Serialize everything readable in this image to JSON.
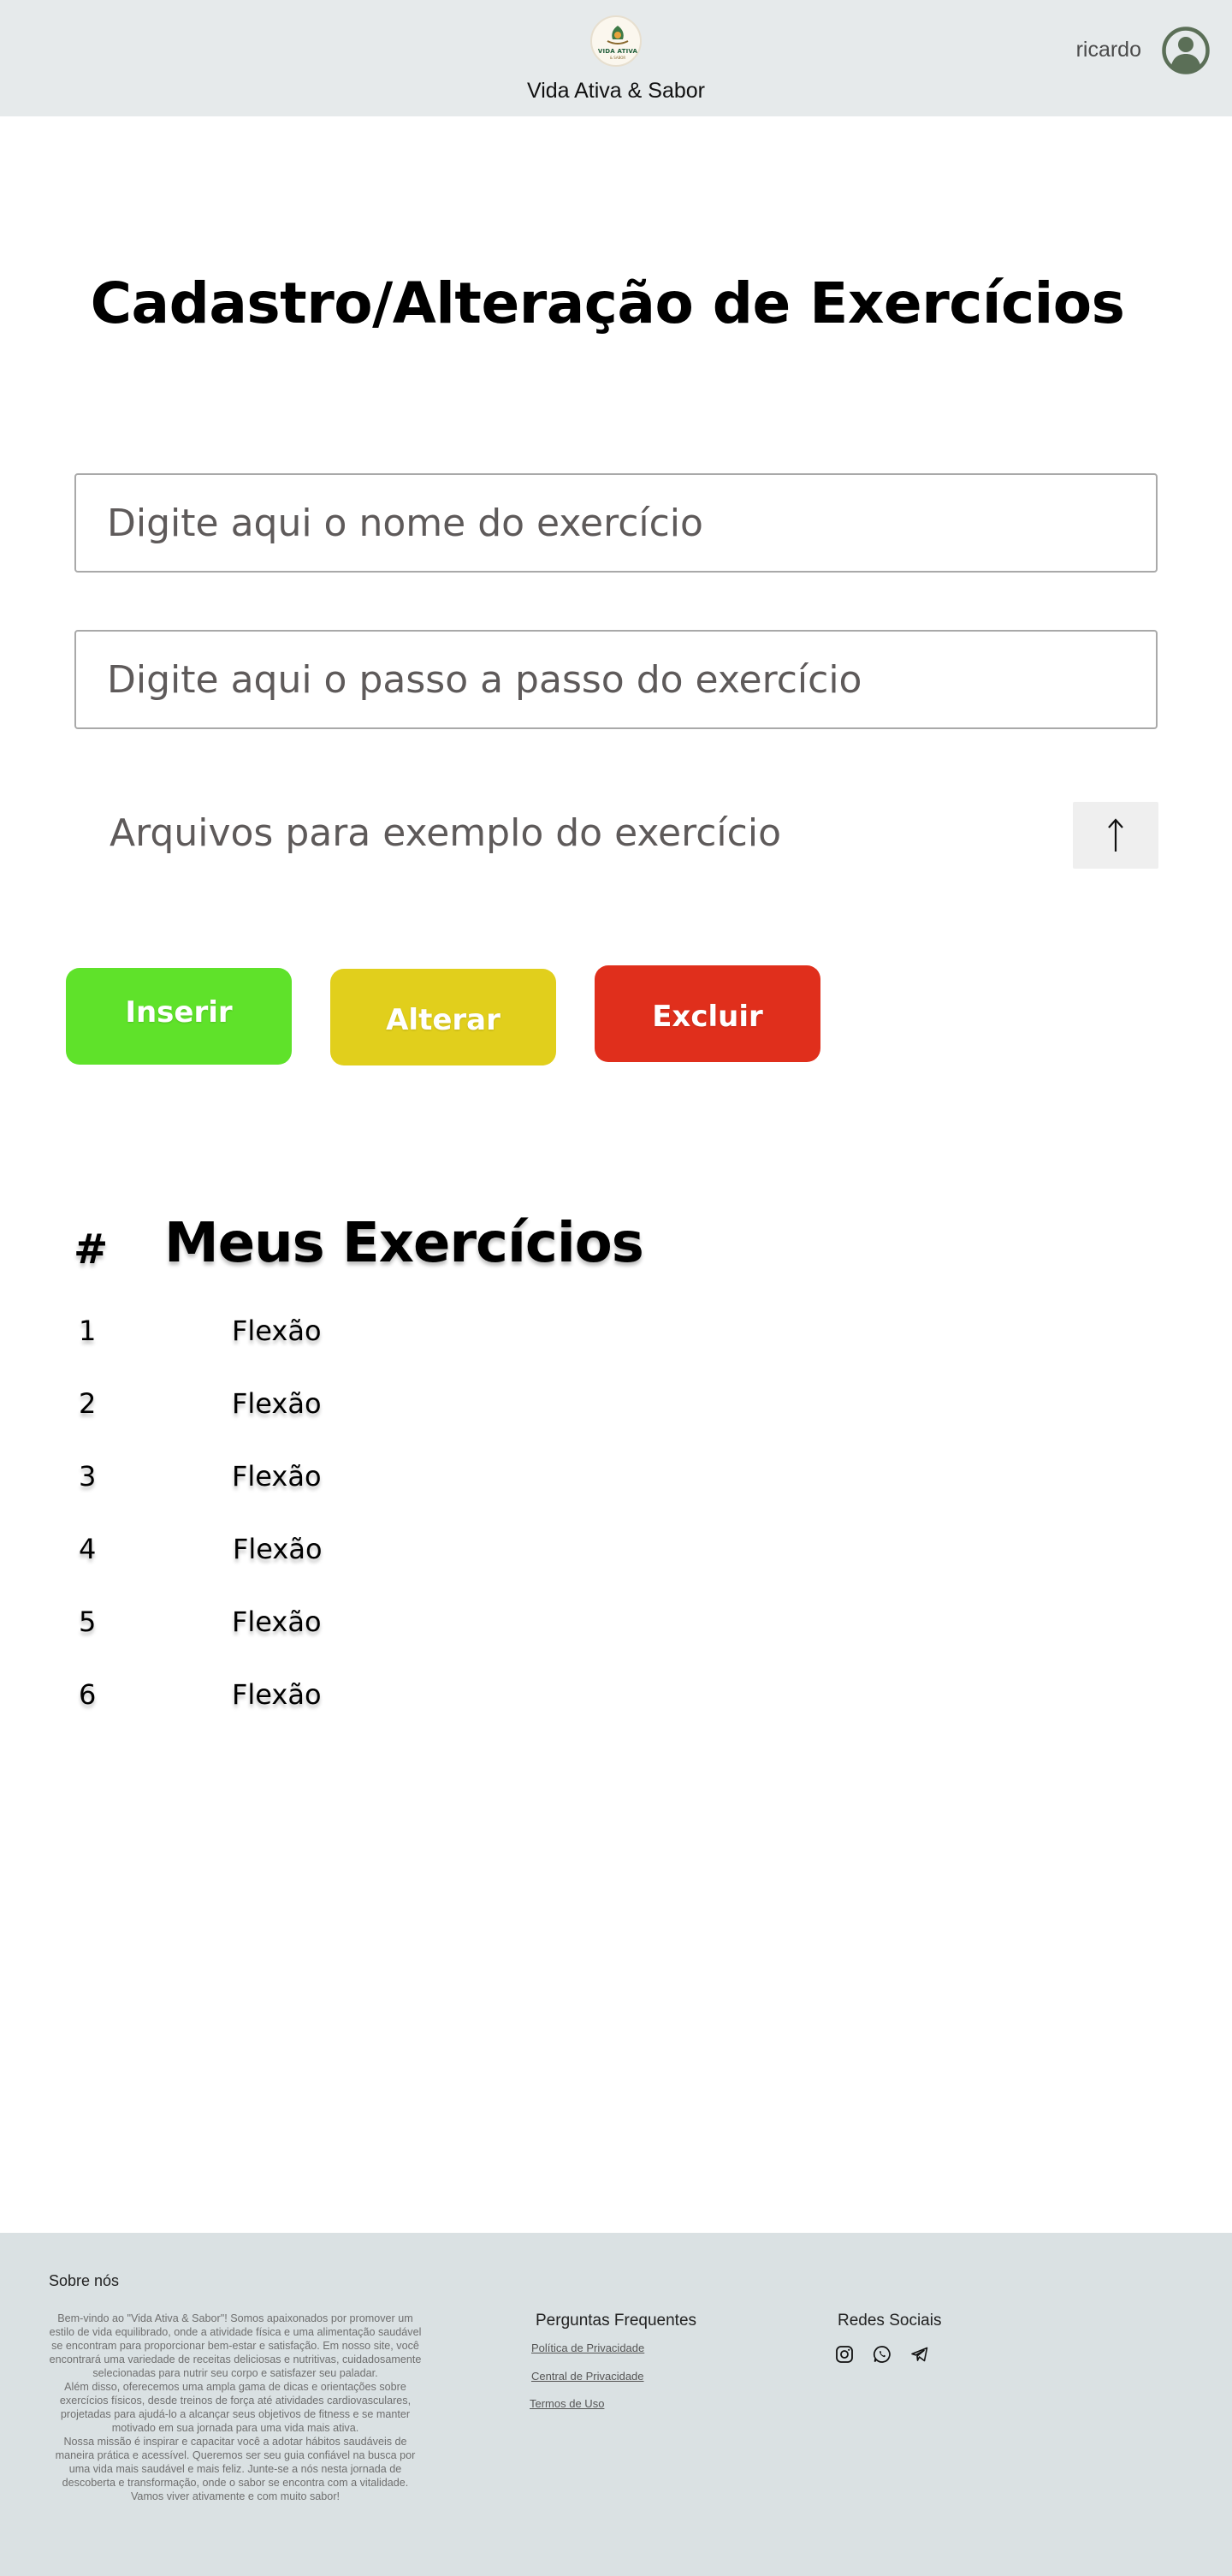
{
  "header": {
    "logo_text": "VIDA ATIVA",
    "logo_subtext": "& SABOR",
    "site_name": "Vida Ativa & Sabor",
    "username": "ricardo",
    "avatar_icon": "user-circle-icon"
  },
  "form": {
    "title": "Cadastro/Alteração de Exercícios",
    "name_placeholder": "Digite aqui o nome do exercício",
    "steps_placeholder": "Digite aqui o passo a passo do exercício",
    "files_label": "Arquivos para exemplo do exercício",
    "upload_icon": "arrow-up-icon"
  },
  "actions": {
    "insert_label": "Inserir",
    "alter_label": "Alterar",
    "delete_label": "Excluir",
    "colors": {
      "insert": "#5fe22a",
      "alter": "#e1cf1c",
      "delete": "#e02f1c"
    }
  },
  "list": {
    "hash_header": "#",
    "title": "Meus Exercícios",
    "rows": [
      {
        "num": "1",
        "name": "Flexão"
      },
      {
        "num": "2",
        "name": "Flexão"
      },
      {
        "num": "3",
        "name": "Flexão"
      },
      {
        "num": "4",
        "name": "Flexão"
      },
      {
        "num": "5",
        "name": "Flexão"
      },
      {
        "num": "6",
        "name": "Flexão"
      }
    ]
  },
  "footer": {
    "about_title": "Sobre nós",
    "about_p1": "Bem-vindo ao \"Vida Ativa & Sabor\"! Somos apaixonados por promover um estilo de vida equilibrado, onde a atividade física e uma alimentação saudável se encontram para proporcionar bem-estar e satisfação. Em nosso site, você encontrará uma variedade de receitas deliciosas e nutritivas, cuidadosamente selecionadas para nutrir seu corpo e satisfazer seu paladar.",
    "about_p2": "Além disso, oferecemos uma ampla gama de dicas e orientações sobre exercícios físicos, desde treinos de força até atividades cardiovasculares, projetadas para ajudá-lo a alcançar seus objetivos de fitness e se manter motivado em sua jornada para uma vida mais ativa.",
    "about_p3": "Nossa missão é inspirar e capacitar você a adotar hábitos saudáveis de maneira prática e acessível. Queremos ser seu guia confiável na busca por uma vida mais saudável e mais feliz. Junte-se a nós nesta jornada de descoberta e transformação, onde o sabor se encontra com a vitalidade. Vamos viver ativamente e com muito sabor!",
    "faq_title": "Perguntas Frequentes",
    "links": [
      "Política de Privacidade",
      "Central de Privacidade",
      "Termos de Uso"
    ],
    "social_title": "Redes Sociais",
    "social_icons": [
      "instagram-icon",
      "whatsapp-icon",
      "telegram-icon"
    ]
  }
}
